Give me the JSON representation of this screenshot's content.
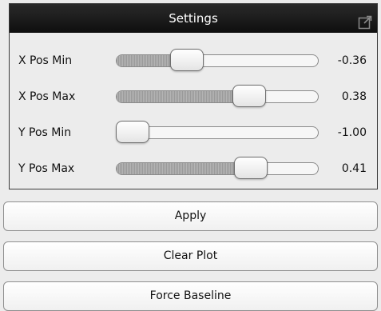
{
  "settings": {
    "title": "Settings",
    "detach_icon": "detach-window-icon",
    "sliders": [
      {
        "label": "X Pos Min",
        "value": "-0.36",
        "fraction": 0.32
      },
      {
        "label": "X Pos Max",
        "value": "0.38",
        "fraction": 0.69
      },
      {
        "label": "Y Pos Min",
        "value": "-1.00",
        "fraction": 0.0
      },
      {
        "label": "Y Pos Max",
        "value": "0.41",
        "fraction": 0.7
      }
    ]
  },
  "buttons": {
    "apply": "Apply",
    "clear_plot": "Clear Plot",
    "force_baseline": "Force Baseline"
  }
}
